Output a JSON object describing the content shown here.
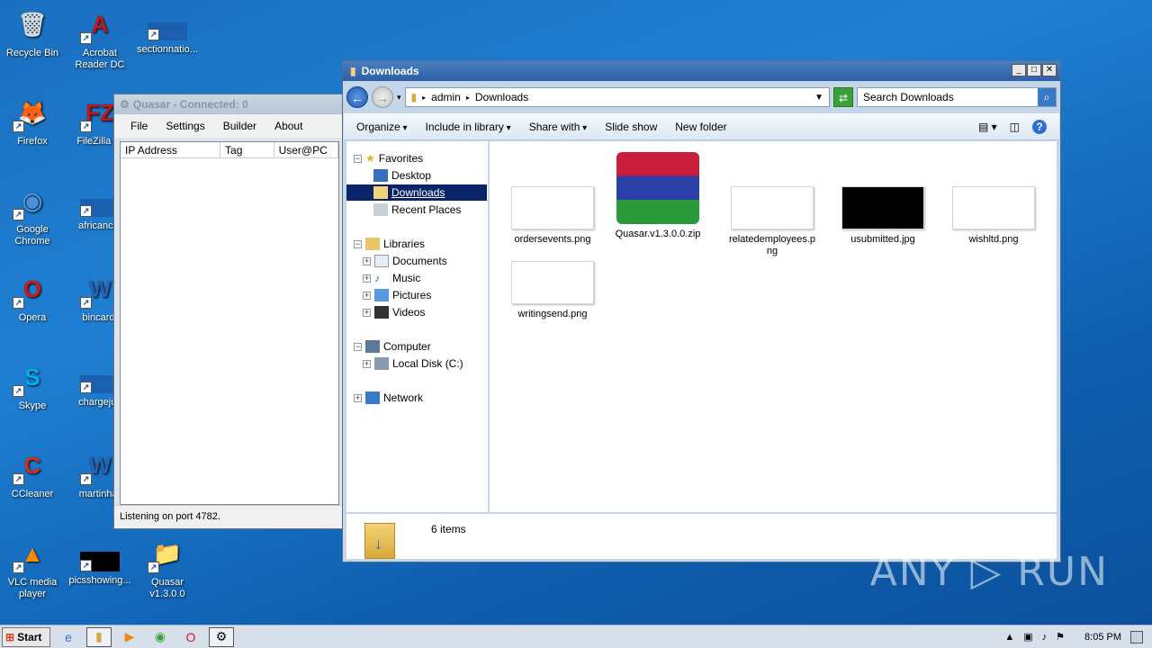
{
  "desktop": {
    "icons": [
      {
        "label": "Recycle Bin",
        "glyph": "🗑",
        "color": "#d0d8e0"
      },
      {
        "label": "Acrobat Reader DC",
        "glyph": "A",
        "color": "#c01818"
      },
      {
        "label": "sectionnatio...",
        "glyph": "",
        "color": "#1a5fb0"
      },
      {
        "label": "Firefox",
        "glyph": "🦊",
        "color": "#ff7a1a"
      },
      {
        "label": "FileZilla Cl",
        "glyph": "FZ",
        "color": "#c01818"
      },
      {
        "label": "Google Chrome",
        "glyph": "◉",
        "color": "#4a90d9"
      },
      {
        "label": "africancut",
        "glyph": "",
        "color": "#1a5fb0"
      },
      {
        "label": "Opera",
        "glyph": "O",
        "color": "#d01818"
      },
      {
        "label": "bincard.",
        "glyph": "W",
        "color": "#2b5fb0"
      },
      {
        "label": "Skype",
        "glyph": "S",
        "color": "#00aff0"
      },
      {
        "label": "chargejus",
        "glyph": "",
        "color": "#1a5fb0"
      },
      {
        "label": "CCleaner",
        "glyph": "C",
        "color": "#d03020"
      },
      {
        "label": "martinhar",
        "glyph": "W",
        "color": "#2b5fb0"
      },
      {
        "label": "VLC media player",
        "glyph": "▲",
        "color": "#ff8800"
      },
      {
        "label": "picsshowing...",
        "glyph": "",
        "color": "#000000"
      },
      {
        "label": "Quasar v1.3.0.0",
        "glyph": "📁",
        "color": "#e8c66a"
      }
    ]
  },
  "quasar": {
    "title": "Quasar - Connected: 0",
    "menu": [
      "File",
      "Settings",
      "Builder",
      "About"
    ],
    "columns": [
      "IP Address",
      "Tag",
      "User@PC"
    ],
    "status": "Listening on port 4782."
  },
  "explorer": {
    "title": "Downloads",
    "breadcrumb": [
      "admin",
      "Downloads"
    ],
    "search_placeholder": "Search Downloads",
    "toolbar": {
      "organize": "Organize",
      "include": "Include in library",
      "share": "Share with",
      "slideshow": "Slide show",
      "newfolder": "New folder"
    },
    "nav": {
      "favorites": "Favorites",
      "desktop": "Desktop",
      "downloads": "Downloads",
      "recent": "Recent Places",
      "libraries": "Libraries",
      "documents": "Documents",
      "music": "Music",
      "pictures": "Pictures",
      "videos": "Videos",
      "computer": "Computer",
      "localdisk": "Local Disk (C:)",
      "network": "Network"
    },
    "files": [
      {
        "name": "ordersevents.png",
        "thumb": "white"
      },
      {
        "name": "Quasar.v1.3.0.0.zip",
        "thumb": "rar"
      },
      {
        "name": "relatedemployees.png",
        "thumb": "white"
      },
      {
        "name": "usubmitted.jpg",
        "thumb": "black"
      },
      {
        "name": "wishltd.png",
        "thumb": "white"
      },
      {
        "name": "writingsend.png",
        "thumb": "white"
      }
    ],
    "item_count": "6 items"
  },
  "taskbar": {
    "start": "Start",
    "time": "8:05 PM"
  },
  "watermark": "ANY ▷ RUN"
}
